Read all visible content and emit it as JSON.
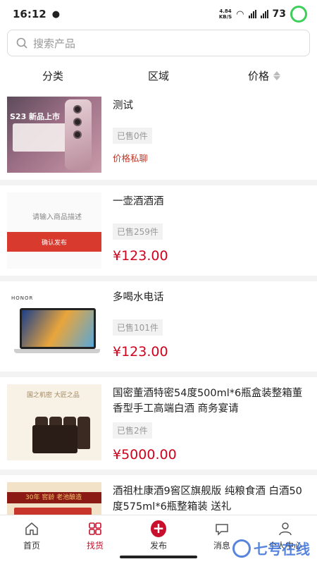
{
  "status": {
    "time": "16:12",
    "net_speed_top": "4.84",
    "net_speed_bottom": "KB/S",
    "signal": "4G",
    "battery": "73"
  },
  "search": {
    "placeholder": "搜索产品"
  },
  "filters": [
    {
      "label": "分类"
    },
    {
      "label": "区域"
    },
    {
      "label": "价格"
    }
  ],
  "products": [
    {
      "title": "测试",
      "sold": "已售0件",
      "price": "价格私聊",
      "thumb_text": "S23 新品上市"
    },
    {
      "title": "一壶酒酒酒",
      "sold": "已售259件",
      "price": "¥123.00",
      "thumb_text": "请输入商品描述",
      "thumb_button": "确认发布"
    },
    {
      "title": "多喝水电话",
      "sold": "已售101件",
      "price": "¥123.00",
      "thumb_text": "HONOR"
    },
    {
      "title": "国密董酒特密54度500ml*6瓶盒装整箱董香型手工高端白酒 商务宴请",
      "sold": "已售2件",
      "price": "¥5000.00",
      "thumb_text": "国之机密 大匠之品"
    },
    {
      "title": "酒祖杜康酒9窖区旗舰版 纯粮食酒 白酒50度575ml*6瓶整箱装 送礼",
      "sold": "",
      "price": "",
      "thumb_text": "30年 窖龄 老池酿造"
    }
  ],
  "tabs": [
    {
      "label": "首页"
    },
    {
      "label": "找货"
    },
    {
      "label": "发布"
    },
    {
      "label": "消息"
    },
    {
      "label": "个人中心"
    }
  ],
  "watermark": "七号在线",
  "colors": {
    "accent": "#c8102e",
    "price": "#d0021b"
  }
}
